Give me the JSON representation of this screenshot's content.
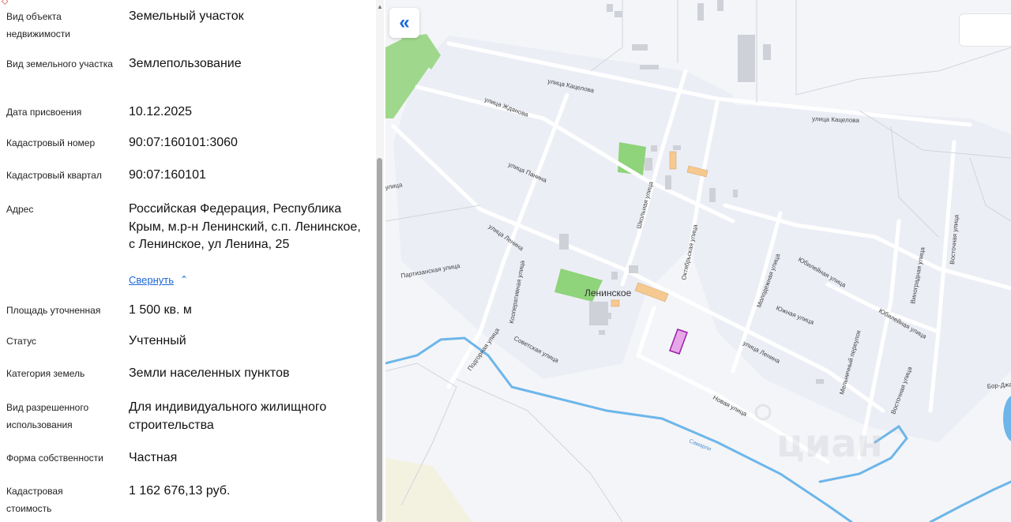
{
  "properties": [
    {
      "label": "Вид объекта недвижимости",
      "value": "Земельный участок"
    },
    {
      "label": "Вид земельного участка",
      "value": "Землепользование"
    },
    {
      "label": "Дата присвоения",
      "value": "10.12.2025"
    },
    {
      "label": "Кадастровый номер",
      "value": "90:07:160101:3060"
    },
    {
      "label": "Кадастровый квартал",
      "value": "90:07:160101"
    },
    {
      "label": "Адрес",
      "value": "Российская Федерация, Республика Крым, м.р-н Ленинский, с.п. Ленинское, с Ленинское, ул Ленина, 25"
    },
    {
      "label": "Площадь уточненная",
      "value": "1 500 кв. м"
    },
    {
      "label": "Статус",
      "value": "Учтенный"
    },
    {
      "label": "Категория земель",
      "value": "Земли населенных пунктов"
    },
    {
      "label": "Вид разрешенного использования",
      "value": "Для индивидуального жилищного строительства"
    },
    {
      "label": "Форма собственности",
      "value": "Частная"
    },
    {
      "label": "Кадастровая стоимость",
      "value": "1 162 676,13 руб."
    }
  ],
  "collapse_label": "Свернуть",
  "icons": {
    "collapse": "chevron-up-icon",
    "map_toggle": "double-chevron-left-icon"
  },
  "map": {
    "town": "Ленинское",
    "streets": [
      "улица Кацелова",
      "улица Кацелова",
      "улица Жданова",
      "улица Панина",
      "улица",
      "улица Ленина",
      "Школьная улица",
      "Октябрьская улица",
      "Партизанская улица",
      "Кооперативная улица",
      "Советская улица",
      "Подгорная улица",
      "улица Ленина",
      "Новая улица",
      "Молодежная улица",
      "Юбилейная улица",
      "Южная улица",
      "Юбилейная улица",
      "Виноградная улица",
      "Восточная улица",
      "Восточная улица",
      "Мельничный переулок",
      "Бор-Джа"
    ],
    "river": "Самарли",
    "watermark": "циан",
    "colors": {
      "land": "#eef0f6",
      "block": "#f1f1f8",
      "road": "#ffffff",
      "park": "#8fd37a",
      "water": "#6db6ea",
      "highlight_fill": "#e6a6e8",
      "highlight_stroke": "#9b1fa8",
      "building": "#f5c98f"
    }
  }
}
